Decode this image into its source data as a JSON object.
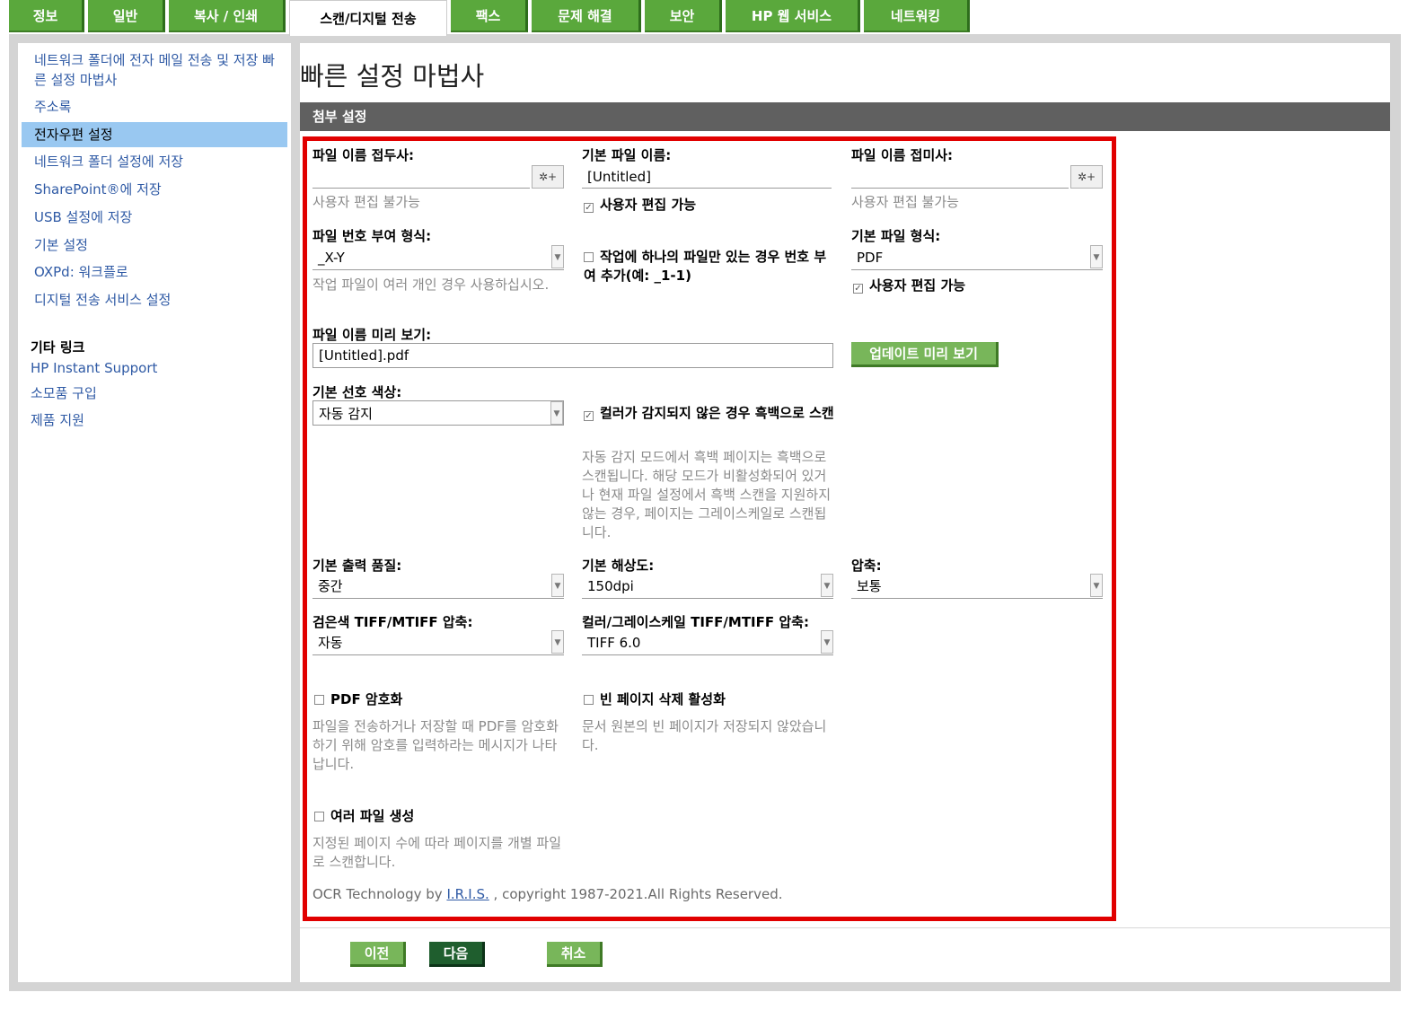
{
  "tabs": [
    "정보",
    "일반",
    "복사 / 인쇄",
    "스캔/디지털 전송",
    "팩스",
    "문제 해결",
    "보안",
    "HP 웹 서비스",
    "네트워킹"
  ],
  "sidebar": {
    "items": [
      "네트워크 폴더에 전자 메일 전송 및 저장 빠른 설정 마법사",
      "주소록",
      "전자우편 설정",
      "네트워크 폴더 설정에 저장",
      "SharePoint®에 저장",
      "USB 설정에 저장",
      "기본 설정",
      "OXPd: 워크플로",
      "디지털 전송 서비스 설정"
    ],
    "other_title": "기타 링크",
    "other_links": [
      "HP Instant Support",
      "소모품 구입",
      "제품 지원"
    ]
  },
  "page": {
    "title": "빠른 설정 마법사",
    "section": "첨부 설정"
  },
  "form": {
    "prefix_label": "파일 이름 접두사:",
    "prefix_value": "",
    "prefix_hint": "사용자 편집 불가능",
    "default_name_label": "기본 파일 이름:",
    "default_name_value": "[Untitled]",
    "default_name_editable": "사용자 편집 가능",
    "suffix_label": "파일 이름 접미사:",
    "suffix_value": "",
    "suffix_hint": "사용자 편집 불가능",
    "numbering_label": "파일 번호 부여 형식:",
    "numbering_value": "_X-Y",
    "numbering_hint": "작업 파일이 여러 개인 경우 사용하십시오.",
    "single_file_number": "작업에 하나의 파일만 있는 경우 번호 부여 추가(예: _1-1)",
    "filetype_label": "기본 파일 형식:",
    "filetype_value": "PDF",
    "filetype_editable": "사용자 편집 가능",
    "preview_label": "파일 이름 미리 보기:",
    "preview_value": "[Untitled].pdf",
    "update_preview": "업데이트 미리 보기",
    "color_label": "기본 선호 색상:",
    "color_value": "자동 감지",
    "bw_scan": "컬러가 감지되지 않은 경우 흑백으로 스캔",
    "bw_hint": "자동 감지 모드에서 흑백 페이지는 흑백으로 스캔됩니다. 해당 모드가 비활성화되어 있거나 현재 파일 설정에서 흑백 스캔을 지원하지 않는 경우, 페이지는 그레이스케일로 스캔됩니다.",
    "quality_label": "기본 출력 품질:",
    "quality_value": "중간",
    "resolution_label": "기본 해상도:",
    "resolution_value": "150dpi",
    "compression_label": "압축:",
    "compression_value": "보통",
    "bw_tiff_label": "검은색 TIFF/MTIFF 압축:",
    "bw_tiff_value": "자동",
    "color_tiff_label": "컬러/그레이스케일 TIFF/MTIFF 압축:",
    "color_tiff_value": "TIFF 6.0",
    "pdf_encrypt": "PDF 암호화",
    "pdf_encrypt_hint": "파일을 전송하거나 저장할 때 PDF를 암호화하기 위해 암호를 입력하라는 메시지가 나타납니다.",
    "blank_page": "빈 페이지 삭제 활성화",
    "blank_page_hint": "문서 원본의 빈 페이지가 저장되지 않았습니다.",
    "multi_file": "여러 파일 생성",
    "multi_file_hint": "지정된 페이지 수에 따라 페이지를 개별 파일로 스캔합니다.",
    "ocr_pre": "OCR Technology by ",
    "ocr_link": "I.R.I.S.",
    "ocr_post": " , copyright 1987-2021.All Rights Reserved."
  },
  "buttons": {
    "prev": "이전",
    "next": "다음",
    "cancel": "취소"
  },
  "colors": {
    "tab_green": "#5aa83c",
    "active_sidebar": "#99c8f1",
    "highlight": "#e10000"
  }
}
